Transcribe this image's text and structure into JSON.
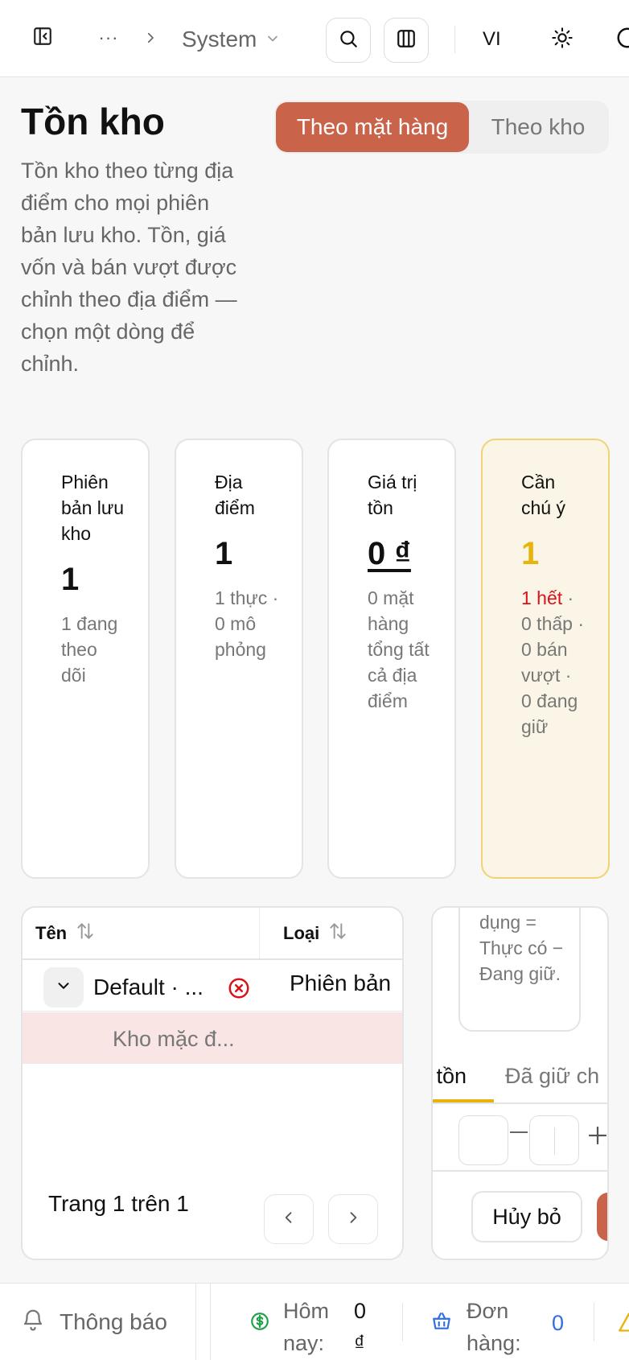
{
  "header": {
    "more": "···",
    "workspace": "System",
    "language": "VI"
  },
  "page": {
    "title": "Tồn kho",
    "description": "Tồn kho theo từng địa điểm cho mọi phiên bản lưu kho. Tồn, giá vốn và bán vượt được chỉnh theo địa điểm — chọn một dòng để chỉnh."
  },
  "view_toggle": {
    "by_item": "Theo mặt hàng",
    "by_warehouse": "Theo kho",
    "selected": "Theo mặt hàng"
  },
  "stats": [
    {
      "label": "Phiên bản lưu kho",
      "value": "1",
      "sub": "1 đang theo dõi"
    },
    {
      "label": "Địa điểm",
      "value": "1",
      "sub": "1 thực · 0 mô phỏng"
    },
    {
      "label": "Giá trị tồn",
      "value": "0 ₫",
      "sub": "0 mặt hàng tổng tất cả địa điểm"
    },
    {
      "label": "Cần chú ý",
      "value": "1",
      "alert": "1 hết",
      "sub": "· 0 thấp · 0 bán vượt · 0 đang giữ"
    }
  ],
  "table": {
    "columns": [
      {
        "label": "Tên"
      },
      {
        "label": "Loại"
      }
    ],
    "rows": [
      {
        "name": "Default · ...",
        "type": "Phiên bản"
      },
      {
        "name": "Kho mặc đ..."
      }
    ],
    "pagination": "Trang 1 trên 1"
  },
  "editor": {
    "note": "dụng = Thực có − Đang giữ.",
    "tabs": [
      {
        "label": "a tồn"
      },
      {
        "label": "Đã giữ ch"
      }
    ],
    "cancel": "Hủy bỏ"
  },
  "statusbar": {
    "notifications": "Thông báo",
    "today_label": "Hôm nay:",
    "today_value": "0 ₫",
    "orders_label": "Đơn hàng:",
    "orders_value": "0"
  },
  "colors": {
    "accent": "#c9644a",
    "warning": "#e6b30f",
    "alert": "#d9121c",
    "link": "#2f6fe0",
    "money": "#22a04b"
  }
}
